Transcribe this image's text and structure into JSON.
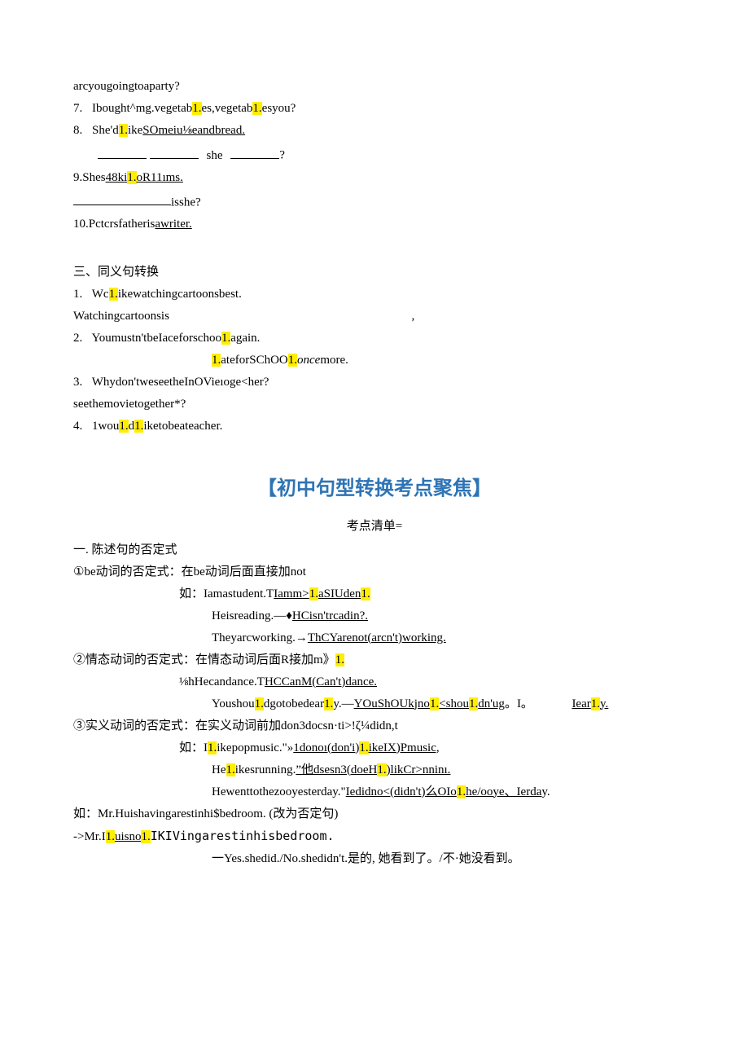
{
  "q6_line": "arcyougoingtoaparty?",
  "q7": {
    "num": "7.",
    "pre": "Ibought^mg.vegetab",
    "hl1": "1.",
    "mid": "es,vegetab",
    "hl2": "1.",
    "post": "esyou?"
  },
  "q8": {
    "num": "8.",
    "pre": "She'd",
    "hl": "1.",
    "post_pre": "ike",
    "underlined": "SOmeiu⅛eandbread.",
    "blank_she": "she",
    "qmark": "?"
  },
  "q9": {
    "num": "9.Shes",
    "underlined_pre": "48ki",
    "hl": "1.",
    "underlined_post": "oR11ıms.",
    "q": "isshe?"
  },
  "q10": {
    "text_pre": "10.Pctcrsfatheris",
    "underlined": "awriter."
  },
  "sec3_title": "三、同义句转换",
  "s3_1": {
    "num": "1.",
    "pre": "Wc",
    "hl": "1.",
    "post": "ikewatchingcartoonsbest."
  },
  "s3_1b": {
    "text": "Watchingcartoonsis",
    "comma": ","
  },
  "s3_2": {
    "num": "2.",
    "pre": "Youmustn'tbeIaceforschoo",
    "hl": "1.",
    "post": "again."
  },
  "s3_2b": {
    "hl": "1.",
    "mid": "ateforSChOO",
    "hl2": "1.",
    "ital": "once",
    "post": "more."
  },
  "s3_3": {
    "num": "3.",
    "text": "Whydon'tweseetheInOVieıoge<her?"
  },
  "s3_3b": "seethemovietogether*?",
  "s3_4": {
    "num": "4.",
    "pre": "1wou",
    "hl1": "1.",
    "mid": "d",
    "hl2": "1.",
    "post": "iketobeateacher."
  },
  "header": "【初中句型转换考点聚焦】",
  "subheader": "考点清单=",
  "sec_a": "一. 陈述句的否定式",
  "a1": "①be动词的否定式：在be动词后面直接加not",
  "a1_e1_pre": "如：Iamastudent.T",
  "a1_e1_u_pre": "Iamm>",
  "a1_e1_hl": "1.",
  "a1_e1_u_post": "aSIUden",
  "a1_e1_hl2": "1.",
  "a1_e2_pre": "Heisreading.—♦",
  "a1_e2_u": "HCisn'trcadin?.",
  "a1_e3_pre": "Theyarcworking.→",
  "a1_e3_u": "ThCYarenot(arcn't)working.",
  "a2": "②情态动词的否定式：在情态动词后面R接加m》",
  "a2_hl": "1.",
  "a2_e1_pre": "⅛hHecandance.T",
  "a2_e1_u": "HCCanM(Can't)dance.",
  "a2_e2_pre": "Youshou",
  "a2_e2_hl1": "1.",
  "a2_e2_mid1": "dgotobedear",
  "a2_e2_hl2": "1.",
  "a2_e2_mid2": "y.—",
  "a2_e2_u1": "YOuShOUkjno",
  "a2_e2_hl3": "1.",
  "a2_e2_u1b": "<shou",
  "a2_e2_hl4": "1.",
  "a2_e2_u1c": "dn'ug",
  "a2_e2_mid3": "。I。",
  "a2_e2_u2": "Iear",
  "a2_e2_hl5": "1.",
  "a2_e2_u2b": "y.",
  "a3": "③实义动词的否定式：在实义动词前加don3docsn·ti>!ζ¼didn,t",
  "a3_e1_pre": "如：I",
  "a3_e1_hl": "1.",
  "a3_e1_mid": "ikepopmusic.\"»",
  "a3_e1_u": "1donoı(don'i)",
  "a3_e1_hl2": "1.",
  "a3_e1_u2": "ikeIX)Pmusic,",
  "a3_e2_pre": "He",
  "a3_e2_hl": "1.",
  "a3_e2_mid": "ikesrunning.",
  "a3_e2_u1": "”他dsesn3(doeH",
  "a3_e2_hl2": "1.",
  "a3_e2_u1b": ")likCr>nninı.",
  "a3_e3_pre": "Hewenttothezooyesterday.\"",
  "a3_e3_u": "Iedidno<(didn't)么OIo",
  "a3_e3_hl": "1.",
  "a3_e3_u2": "he/ooye、Ierda",
  "a3_e3_post": "y.",
  "a_ex_pre": "如：Mr.Huishavingarestinhi$bedroom. (改为否定句)",
  "a_ex2_pre": "->Mr.I",
  "a_ex2_hl": "1.",
  "a_ex2_u": "uisno",
  "a_ex2_hl2": "1.",
  "a_ex2_post": "IKIVingarestinhisbedroom.",
  "a_ex3": "一Yes.shedid./No.shedidn't.是的, 她看到了。/不·她没看到。"
}
